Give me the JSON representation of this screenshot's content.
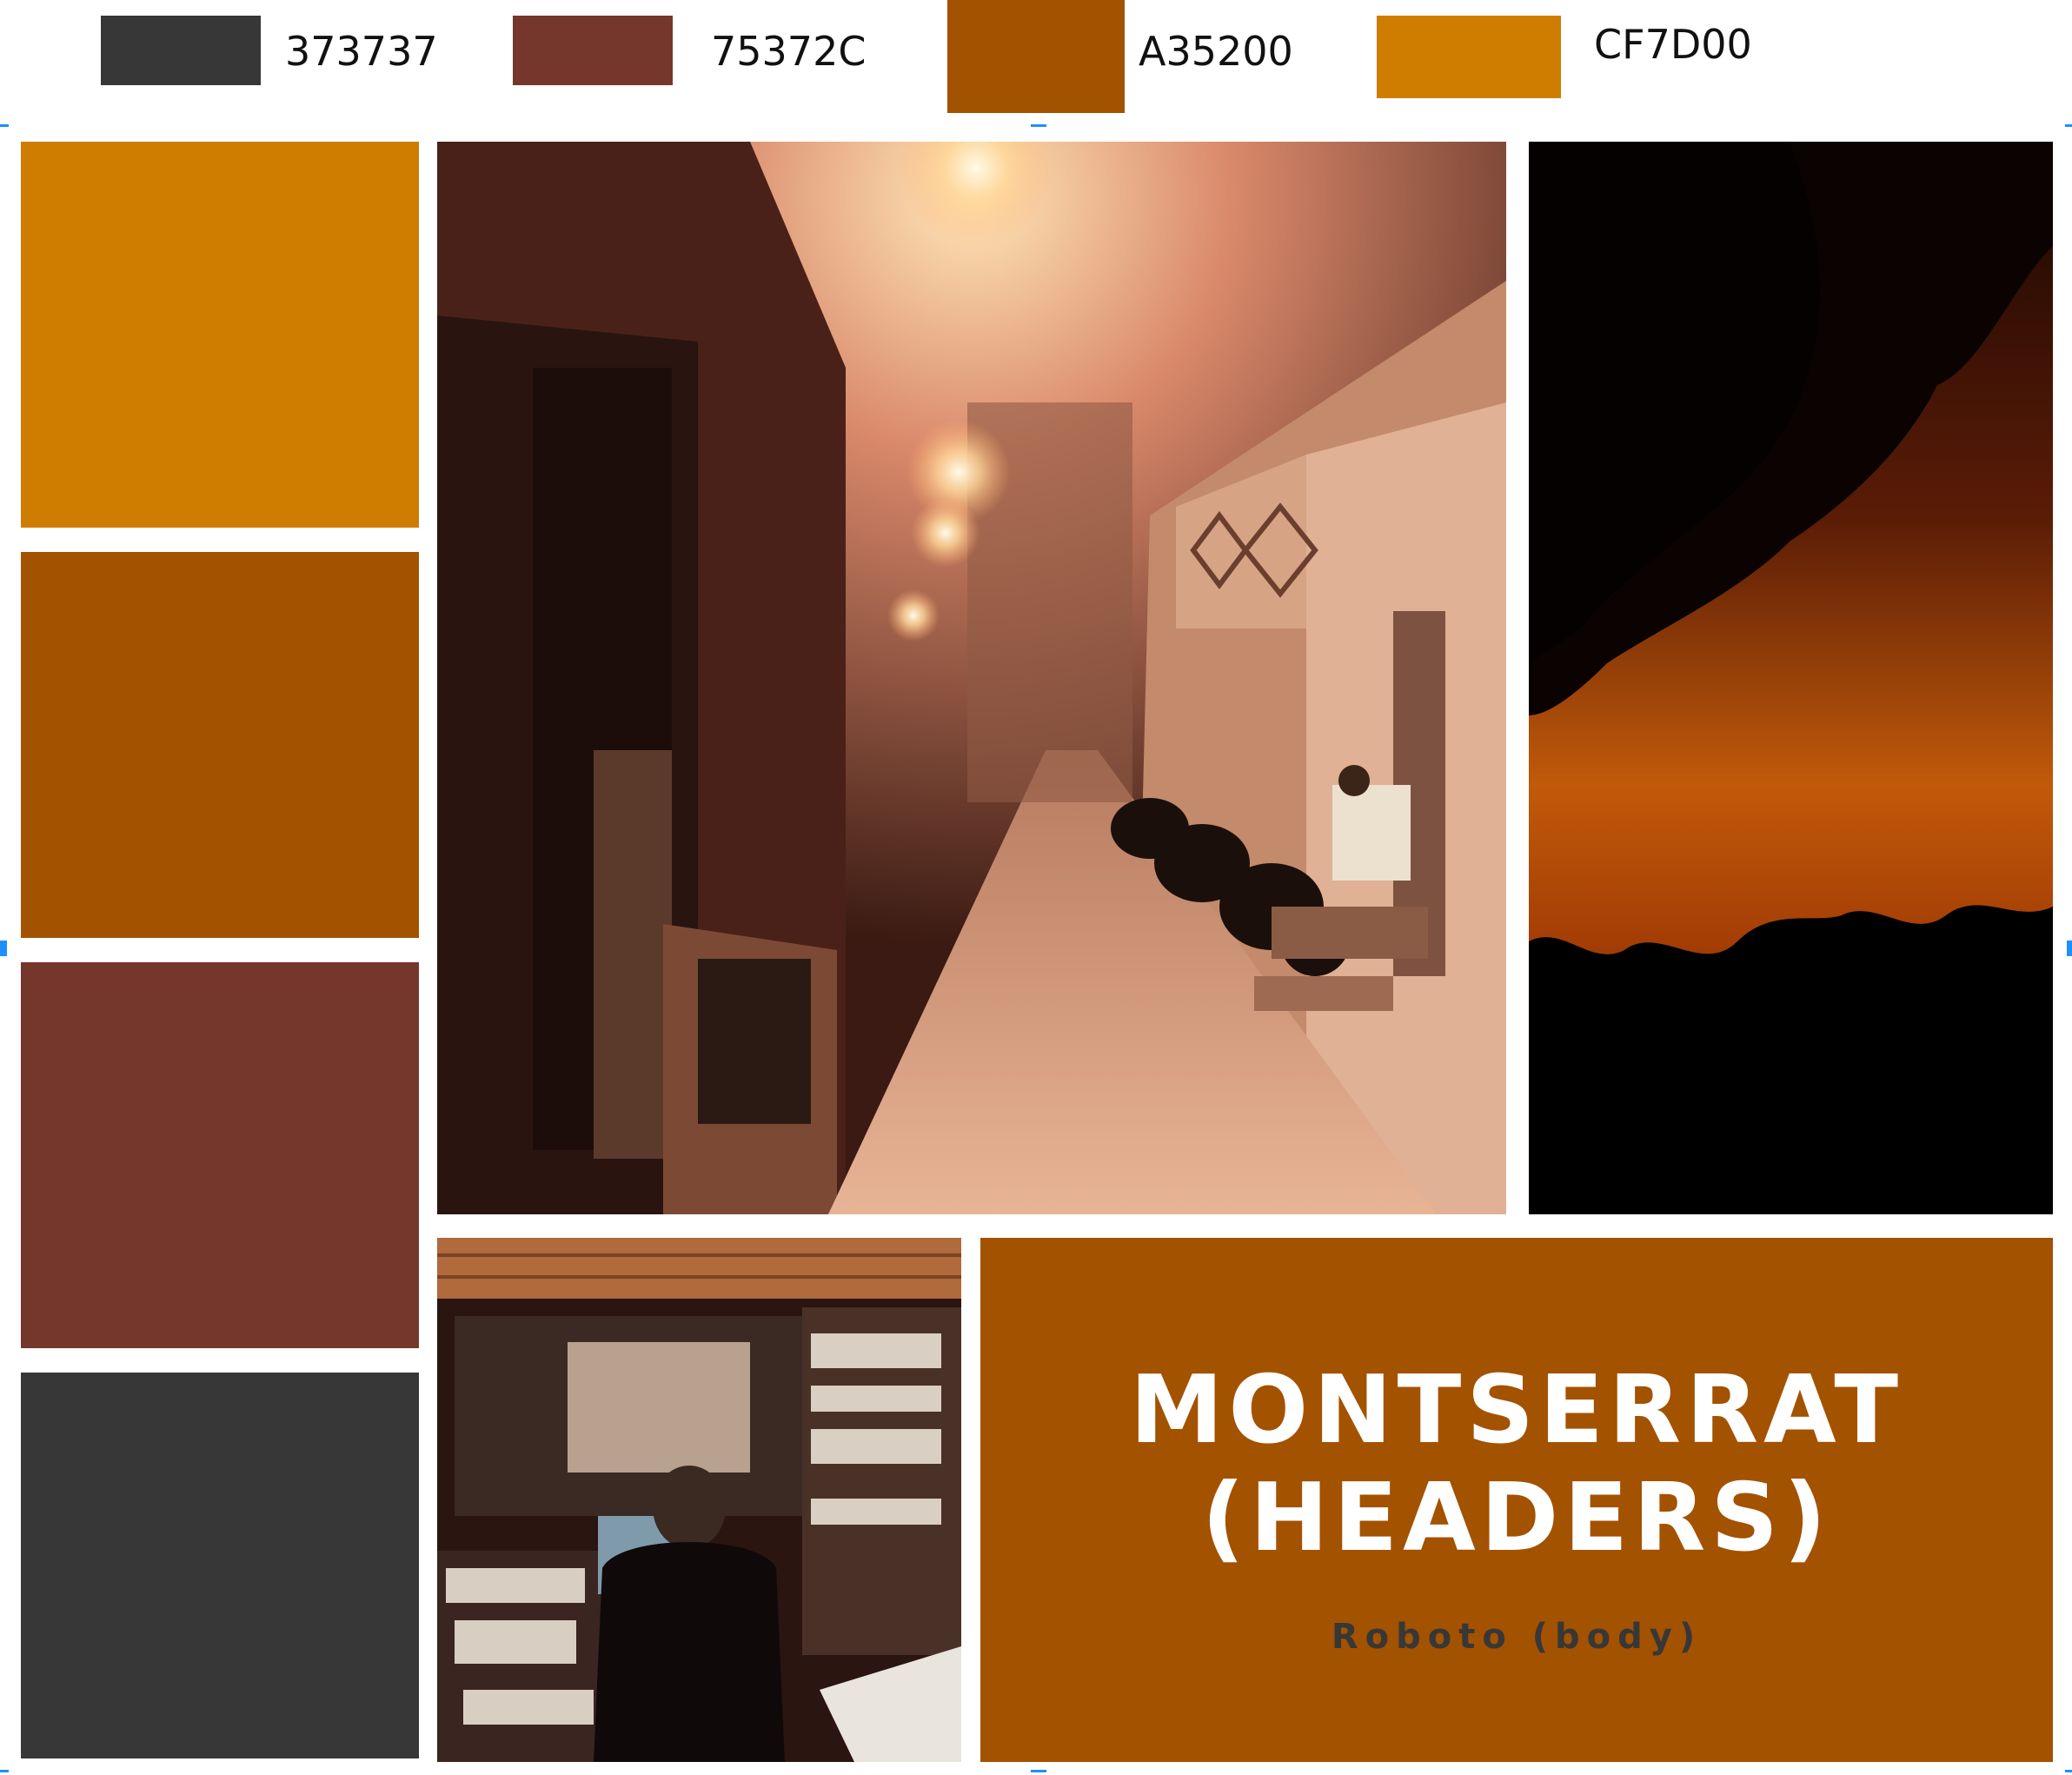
{
  "palette": [
    {
      "hex": "373737",
      "color": "#373737"
    },
    {
      "hex": "75372C",
      "color": "#75372C"
    },
    {
      "hex": "A35200",
      "color": "#A35200"
    },
    {
      "hex": "CF7D00",
      "color": "#CF7D00"
    }
  ],
  "tiles": [
    {
      "color": "#CF7D00"
    },
    {
      "color": "#A35200"
    },
    {
      "color": "#75372C"
    },
    {
      "color": "#373737"
    }
  ],
  "typography": {
    "header_line1": "MONTSERRAT",
    "header_line2": "(HEADERS)",
    "body": "Roboto (body)"
  }
}
